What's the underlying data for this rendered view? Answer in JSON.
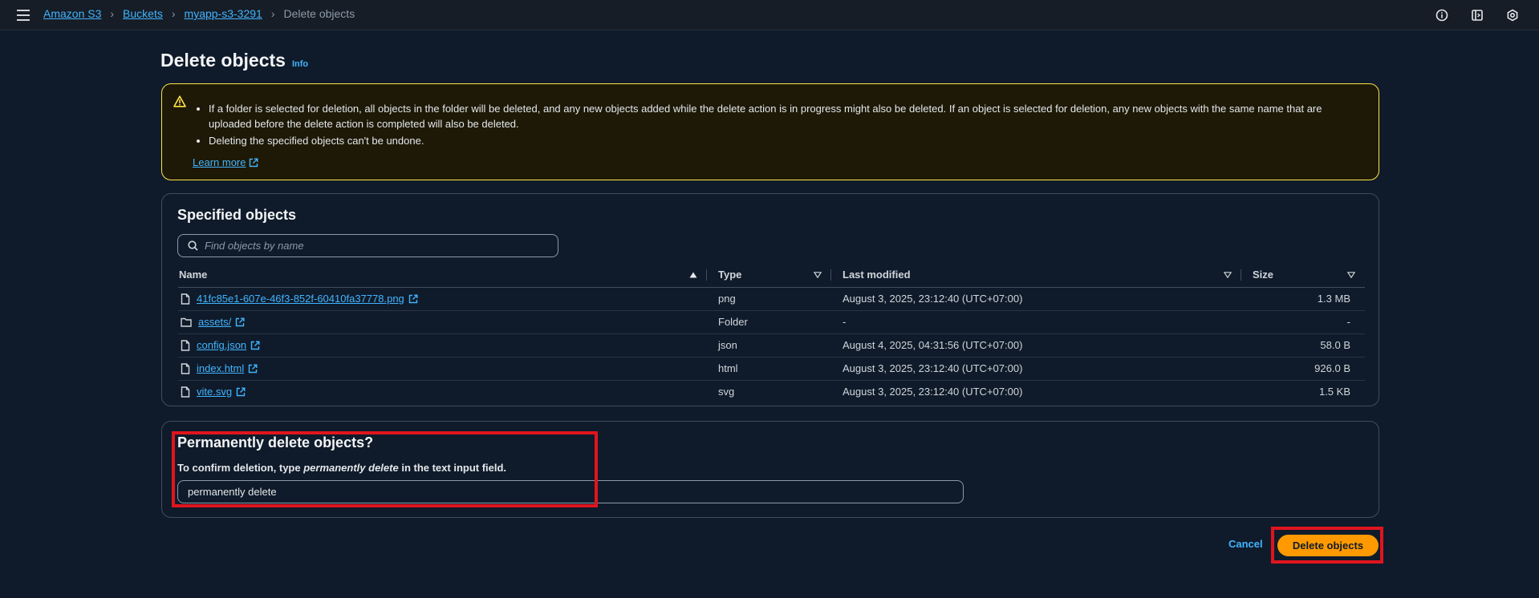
{
  "breadcrumb": {
    "items": [
      "Amazon S3",
      "Buckets",
      "myapp-s3-3291"
    ],
    "current": "Delete objects"
  },
  "page": {
    "title": "Delete objects",
    "info": "Info"
  },
  "warning": {
    "bullets": [
      "If a folder is selected for deletion, all objects in the folder will be deleted, and any new objects added while the delete action is in progress might also be deleted. If an object is selected for deletion, any new objects with the same name that are uploaded before the delete action is completed will also be deleted.",
      "Deleting the specified objects can't be undone."
    ],
    "learn_more": "Learn more"
  },
  "objects": {
    "title": "Specified objects",
    "search_placeholder": "Find objects by name",
    "columns": [
      "Name",
      "Type",
      "Last modified",
      "Size"
    ],
    "rows": [
      {
        "name": "41fc85e1-607e-46f3-852f-60410fa37778.png",
        "icon": "file-icon",
        "type": "png",
        "modified": "August 3, 2025, 23:12:40 (UTC+07:00)",
        "size": "1.3 MB"
      },
      {
        "name": "assets/",
        "icon": "folder-icon",
        "type": "Folder",
        "modified": "-",
        "size": "-"
      },
      {
        "name": "config.json",
        "icon": "file-icon",
        "type": "json",
        "modified": "August 4, 2025, 04:31:56 (UTC+07:00)",
        "size": "58.0 B"
      },
      {
        "name": "index.html",
        "icon": "file-icon",
        "type": "html",
        "modified": "August 3, 2025, 23:12:40 (UTC+07:00)",
        "size": "926.0 B"
      },
      {
        "name": "vite.svg",
        "icon": "file-icon",
        "type": "svg",
        "modified": "August 3, 2025, 23:12:40 (UTC+07:00)",
        "size": "1.5 KB"
      }
    ]
  },
  "confirm": {
    "title": "Permanently delete objects?",
    "desc_prefix": "To confirm deletion, type ",
    "desc_phrase": "permanently delete",
    "desc_suffix": " in the text input field.",
    "input_value": "permanently delete"
  },
  "footer": {
    "cancel": "Cancel",
    "delete": "Delete objects"
  },
  "colors": {
    "background": "#0f1b2a",
    "link": "#42b4ff",
    "warning_border": "#ffe347",
    "primary_button": "#ff9900",
    "highlight": "#e0141e"
  }
}
